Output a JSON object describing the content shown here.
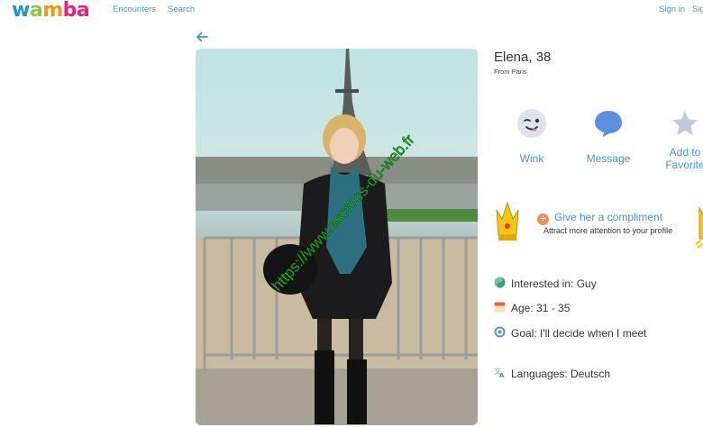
{
  "header": {
    "logo": [
      "w",
      "a",
      "m",
      "b",
      "a"
    ],
    "logo_colors": [
      "#2196c9",
      "#8dc63f",
      "#f7941d",
      "#e6217f",
      "#9b59b6"
    ],
    "nav": {
      "encounters": "Encounters",
      "search": "Search"
    },
    "auth": {
      "sign_in": "Sign in",
      "sign_up": "Sig"
    }
  },
  "profile": {
    "name_age": "Elena, 38",
    "from": "From Paris",
    "photo_watermark": "https://www.escrocs-du-web.fr"
  },
  "actions": {
    "wink": {
      "label": "Wink",
      "icon": "wink-face-icon"
    },
    "message": {
      "label": "Message",
      "icon": "speech-bubble-icon"
    },
    "favorite": {
      "label_line1": "Add to",
      "label_line2": "Favorite",
      "icon": "star-icon"
    }
  },
  "compliment": {
    "title": "Give her a compliment",
    "subtitle": "Attract more attention to your profile"
  },
  "details": {
    "interested_in": "Interested in: Guy",
    "age": "Age: 31 - 35",
    "goal": "Goal: I'll decide when I meet",
    "languages": "Languages: Deutsch"
  },
  "colors": {
    "accent": "#4a90d9",
    "compliment_plus": "#f08b5a"
  }
}
